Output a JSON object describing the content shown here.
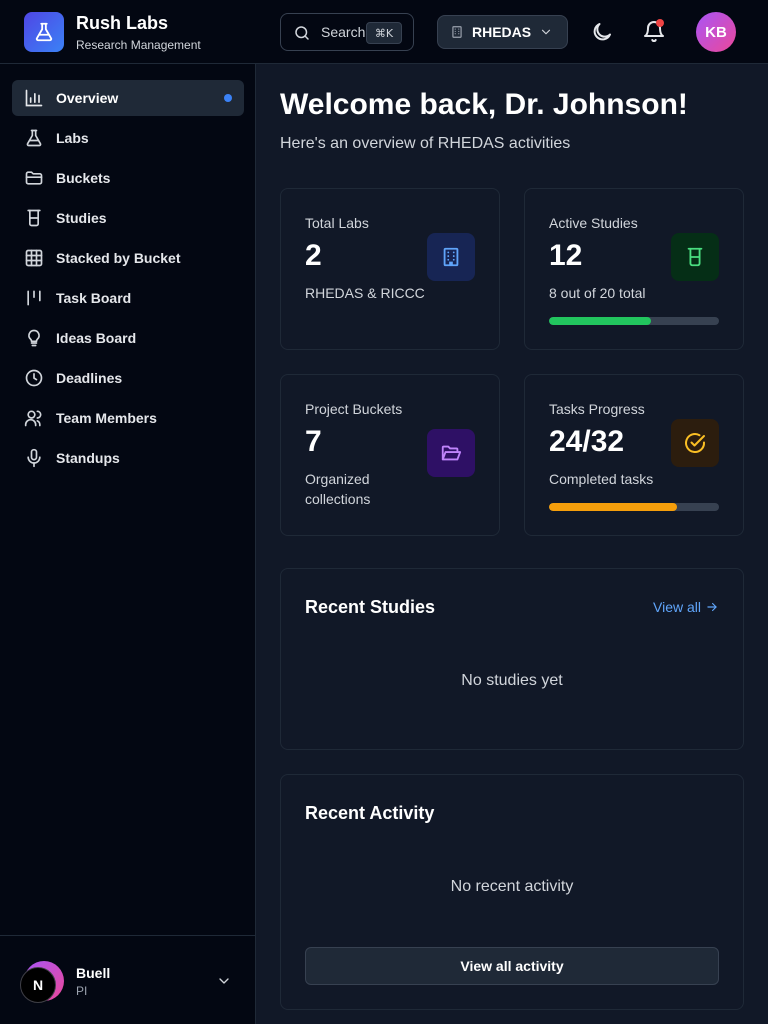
{
  "brand": {
    "name": "Rush Labs",
    "subtitle": "Research Management"
  },
  "header": {
    "search_label": "Search",
    "search_shortcut": "⌘K",
    "lab_selector": "RHEDAS",
    "user_initials": "KB",
    "notification_dot_color": "#ef4444"
  },
  "sidebar": {
    "items": [
      {
        "label": "Overview",
        "icon": "bar-chart-icon",
        "active": true
      },
      {
        "label": "Labs",
        "icon": "flask-icon"
      },
      {
        "label": "Buckets",
        "icon": "folder-icon"
      },
      {
        "label": "Studies",
        "icon": "beaker-icon"
      },
      {
        "label": "Stacked by Bucket",
        "icon": "grid-icon"
      },
      {
        "label": "Task Board",
        "icon": "kanban-icon"
      },
      {
        "label": "Ideas Board",
        "icon": "lightbulb-icon"
      },
      {
        "label": "Deadlines",
        "icon": "clock-icon"
      },
      {
        "label": "Team Members",
        "icon": "users-icon"
      },
      {
        "label": "Standups",
        "icon": "microphone-icon"
      }
    ],
    "user": {
      "name": "Buell",
      "role": "PI",
      "badge": "N"
    }
  },
  "main": {
    "title": "Welcome back, Dr. Johnson!",
    "subtitle": "Here's an overview of RHEDAS activities",
    "stats": {
      "total_labs": {
        "label": "Total Labs",
        "value": "2",
        "sub": "RHEDAS & RICCC",
        "icon": "building-icon"
      },
      "active_studies": {
        "label": "Active Studies",
        "value": "12",
        "sub": "8 out of 20 total",
        "icon": "beaker-icon",
        "progress": 0.6,
        "progress_color": "#22c55e"
      },
      "project_buckets": {
        "label": "Project Buckets",
        "value": "7",
        "sub": "Organized collections",
        "icon": "folder-open-icon"
      },
      "tasks_progress": {
        "label": "Tasks Progress",
        "value": "24/32",
        "sub": "Completed tasks",
        "icon": "check-circle-icon",
        "progress": 0.75,
        "progress_color": "#f59e0b"
      }
    },
    "recent_studies": {
      "title": "Recent Studies",
      "view_all": "View all",
      "empty": "No studies yet"
    },
    "recent_activity": {
      "title": "Recent Activity",
      "empty": "No recent activity",
      "button": "View all activity"
    }
  },
  "colors": {
    "accent": "#3b82f6",
    "brand_gradient_start": "#4f46e5",
    "avatar_gradient_start": "#a855f7",
    "avatar_gradient_end": "#ec4899"
  }
}
